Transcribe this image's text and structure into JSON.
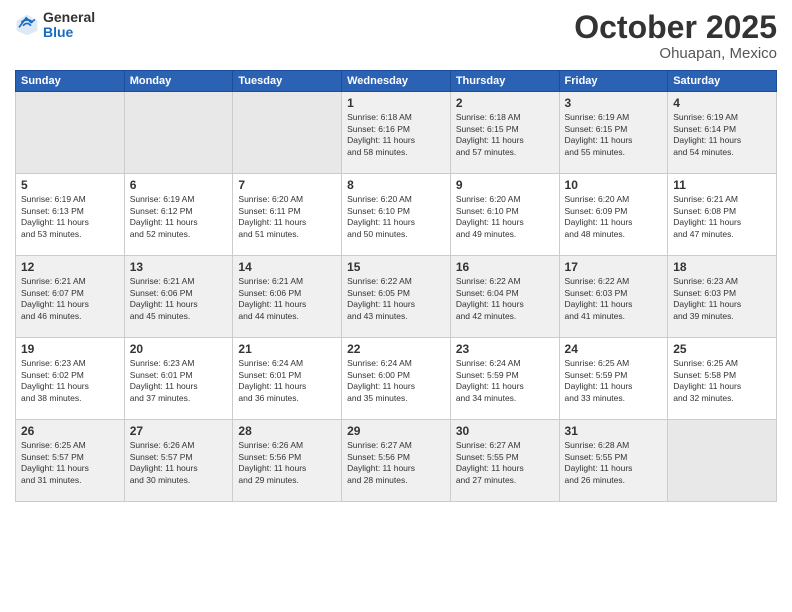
{
  "header": {
    "logo_general": "General",
    "logo_blue": "Blue",
    "month": "October 2025",
    "location": "Ohuapan, Mexico"
  },
  "days_of_week": [
    "Sunday",
    "Monday",
    "Tuesday",
    "Wednesday",
    "Thursday",
    "Friday",
    "Saturday"
  ],
  "weeks": [
    [
      {
        "day": "",
        "info": ""
      },
      {
        "day": "",
        "info": ""
      },
      {
        "day": "",
        "info": ""
      },
      {
        "day": "1",
        "info": "Sunrise: 6:18 AM\nSunset: 6:16 PM\nDaylight: 11 hours\nand 58 minutes."
      },
      {
        "day": "2",
        "info": "Sunrise: 6:18 AM\nSunset: 6:15 PM\nDaylight: 11 hours\nand 57 minutes."
      },
      {
        "day": "3",
        "info": "Sunrise: 6:19 AM\nSunset: 6:15 PM\nDaylight: 11 hours\nand 55 minutes."
      },
      {
        "day": "4",
        "info": "Sunrise: 6:19 AM\nSunset: 6:14 PM\nDaylight: 11 hours\nand 54 minutes."
      }
    ],
    [
      {
        "day": "5",
        "info": "Sunrise: 6:19 AM\nSunset: 6:13 PM\nDaylight: 11 hours\nand 53 minutes."
      },
      {
        "day": "6",
        "info": "Sunrise: 6:19 AM\nSunset: 6:12 PM\nDaylight: 11 hours\nand 52 minutes."
      },
      {
        "day": "7",
        "info": "Sunrise: 6:20 AM\nSunset: 6:11 PM\nDaylight: 11 hours\nand 51 minutes."
      },
      {
        "day": "8",
        "info": "Sunrise: 6:20 AM\nSunset: 6:10 PM\nDaylight: 11 hours\nand 50 minutes."
      },
      {
        "day": "9",
        "info": "Sunrise: 6:20 AM\nSunset: 6:10 PM\nDaylight: 11 hours\nand 49 minutes."
      },
      {
        "day": "10",
        "info": "Sunrise: 6:20 AM\nSunset: 6:09 PM\nDaylight: 11 hours\nand 48 minutes."
      },
      {
        "day": "11",
        "info": "Sunrise: 6:21 AM\nSunset: 6:08 PM\nDaylight: 11 hours\nand 47 minutes."
      }
    ],
    [
      {
        "day": "12",
        "info": "Sunrise: 6:21 AM\nSunset: 6:07 PM\nDaylight: 11 hours\nand 46 minutes."
      },
      {
        "day": "13",
        "info": "Sunrise: 6:21 AM\nSunset: 6:06 PM\nDaylight: 11 hours\nand 45 minutes."
      },
      {
        "day": "14",
        "info": "Sunrise: 6:21 AM\nSunset: 6:06 PM\nDaylight: 11 hours\nand 44 minutes."
      },
      {
        "day": "15",
        "info": "Sunrise: 6:22 AM\nSunset: 6:05 PM\nDaylight: 11 hours\nand 43 minutes."
      },
      {
        "day": "16",
        "info": "Sunrise: 6:22 AM\nSunset: 6:04 PM\nDaylight: 11 hours\nand 42 minutes."
      },
      {
        "day": "17",
        "info": "Sunrise: 6:22 AM\nSunset: 6:03 PM\nDaylight: 11 hours\nand 41 minutes."
      },
      {
        "day": "18",
        "info": "Sunrise: 6:23 AM\nSunset: 6:03 PM\nDaylight: 11 hours\nand 39 minutes."
      }
    ],
    [
      {
        "day": "19",
        "info": "Sunrise: 6:23 AM\nSunset: 6:02 PM\nDaylight: 11 hours\nand 38 minutes."
      },
      {
        "day": "20",
        "info": "Sunrise: 6:23 AM\nSunset: 6:01 PM\nDaylight: 11 hours\nand 37 minutes."
      },
      {
        "day": "21",
        "info": "Sunrise: 6:24 AM\nSunset: 6:01 PM\nDaylight: 11 hours\nand 36 minutes."
      },
      {
        "day": "22",
        "info": "Sunrise: 6:24 AM\nSunset: 6:00 PM\nDaylight: 11 hours\nand 35 minutes."
      },
      {
        "day": "23",
        "info": "Sunrise: 6:24 AM\nSunset: 5:59 PM\nDaylight: 11 hours\nand 34 minutes."
      },
      {
        "day": "24",
        "info": "Sunrise: 6:25 AM\nSunset: 5:59 PM\nDaylight: 11 hours\nand 33 minutes."
      },
      {
        "day": "25",
        "info": "Sunrise: 6:25 AM\nSunset: 5:58 PM\nDaylight: 11 hours\nand 32 minutes."
      }
    ],
    [
      {
        "day": "26",
        "info": "Sunrise: 6:25 AM\nSunset: 5:57 PM\nDaylight: 11 hours\nand 31 minutes."
      },
      {
        "day": "27",
        "info": "Sunrise: 6:26 AM\nSunset: 5:57 PM\nDaylight: 11 hours\nand 30 minutes."
      },
      {
        "day": "28",
        "info": "Sunrise: 6:26 AM\nSunset: 5:56 PM\nDaylight: 11 hours\nand 29 minutes."
      },
      {
        "day": "29",
        "info": "Sunrise: 6:27 AM\nSunset: 5:56 PM\nDaylight: 11 hours\nand 28 minutes."
      },
      {
        "day": "30",
        "info": "Sunrise: 6:27 AM\nSunset: 5:55 PM\nDaylight: 11 hours\nand 27 minutes."
      },
      {
        "day": "31",
        "info": "Sunrise: 6:28 AM\nSunset: 5:55 PM\nDaylight: 11 hours\nand 26 minutes."
      },
      {
        "day": "",
        "info": ""
      }
    ]
  ]
}
